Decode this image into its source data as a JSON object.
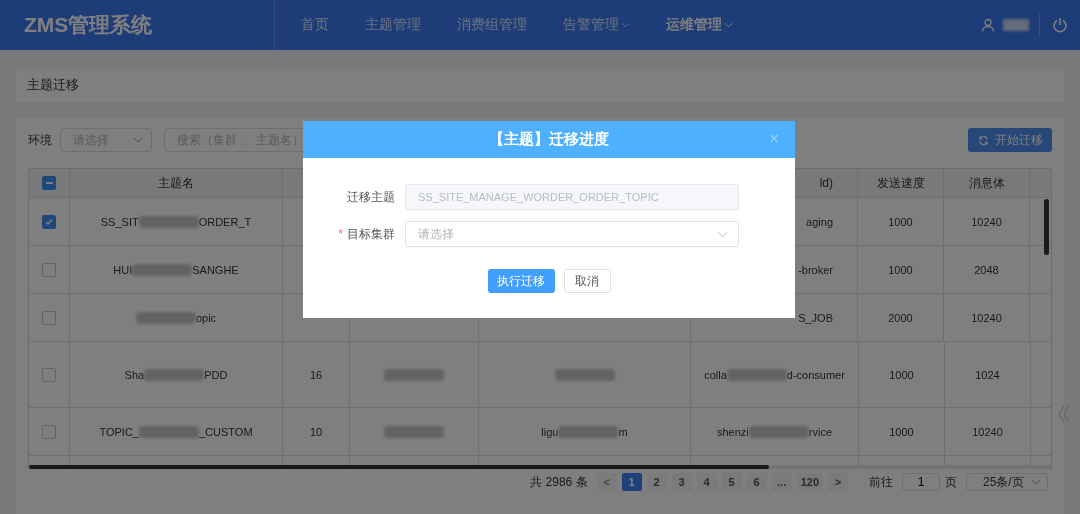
{
  "app": {
    "logo": "ZMS管理系统"
  },
  "nav": [
    {
      "label": "首页",
      "selected": false,
      "dropdown": false
    },
    {
      "label": "主题管理",
      "selected": false,
      "dropdown": false
    },
    {
      "label": "消费组管理",
      "selected": false,
      "dropdown": false
    },
    {
      "label": "告警管理",
      "selected": false,
      "dropdown": true
    },
    {
      "label": "运维管理",
      "selected": true,
      "dropdown": true
    }
  ],
  "page_title": "主题迁移",
  "filters": {
    "env_label": "环境",
    "env_placeholder": "请选择",
    "search_placeholder": "搜索（集群 、 主题名）",
    "start_button": "开始迁移"
  },
  "table": {
    "header_checkbox": {
      "indeterminate": true
    },
    "columns": [
      "主题名",
      null,
      null,
      null,
      "ld)",
      "发送速度",
      "消息体"
    ],
    "rows": [
      {
        "checked": true,
        "cells": [
          {
            "start": "SS_SIT",
            "end": "ORDER_T",
            "redacted": true
          },
          null,
          null,
          null,
          {
            "end": "aging"
          },
          {
            "text": "1000"
          },
          {
            "text": "10240"
          }
        ]
      },
      {
        "checked": false,
        "cells": [
          {
            "start": "HUI",
            "end": "SANGHE",
            "redacted": true
          },
          null,
          null,
          null,
          {
            "end": "-broker"
          },
          {
            "text": "1000"
          },
          {
            "text": "2048"
          }
        ]
      },
      {
        "checked": false,
        "cells": [
          {
            "end": "opic",
            "redacted": true
          },
          null,
          null,
          null,
          {
            "end": "S_JOB"
          },
          {
            "text": "2000"
          },
          {
            "text": "10240"
          }
        ]
      },
      {
        "checked": false,
        "cells": [
          {
            "start": "Sha",
            "end": "PDD",
            "redacted": true
          },
          {
            "text": "16"
          },
          {
            "redacted": true
          },
          {
            "redacted": true
          },
          {
            "start": "colla",
            "end": "d-consumer",
            "redacted": true
          },
          {
            "text": "1000"
          },
          {
            "text": "1024"
          }
        ]
      },
      {
        "checked": false,
        "cells": [
          {
            "start": "TOPIC_",
            "end": "_CUSTOM",
            "redacted": true
          },
          {
            "text": "10"
          },
          {
            "redacted": true
          },
          {
            "start": "ligu",
            "end": "m",
            "redacted": true
          },
          {
            "start": "shenzi",
            "end": "rvice",
            "redacted": true
          },
          {
            "text": "1000"
          },
          {
            "text": "10240"
          }
        ]
      }
    ]
  },
  "pagination": {
    "total": "共 2986 条",
    "prev": "<",
    "pages": [
      {
        "label": "1",
        "selected": true
      },
      {
        "label": "2",
        "selected": false
      },
      {
        "label": "3",
        "selected": false
      },
      {
        "label": "4",
        "selected": false
      },
      {
        "label": "5",
        "selected": false
      },
      {
        "label": "6",
        "selected": false
      },
      {
        "label": "...",
        "selected": false
      },
      {
        "label": "120",
        "selected": false
      }
    ],
    "next": ">",
    "goto_label": "前往",
    "goto_value": "1",
    "page_unit": "页",
    "page_size": "25条/页"
  },
  "dialog": {
    "title": "【主题】迁移进度",
    "close": "×",
    "fields": [
      {
        "label": "迁移主题",
        "kind": "input",
        "value": "SS_SITE_MANAGE_WORDER_ORDER_TOPIC"
      },
      {
        "label": "目标集群",
        "required_mark": "*",
        "kind": "select",
        "placeholder": "请选择"
      }
    ],
    "confirm": "执行迁移",
    "cancel": "取消"
  }
}
